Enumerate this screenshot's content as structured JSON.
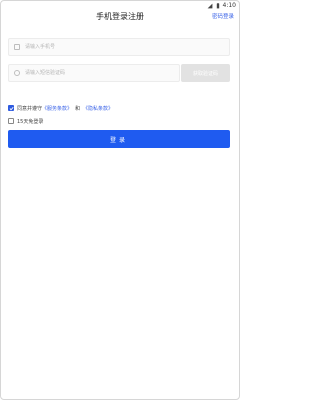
{
  "status": {
    "time": "4:10"
  },
  "header": {
    "title": "手机登录注册",
    "password_login": "密码登录"
  },
  "form": {
    "phone_placeholder": "请输入手机号",
    "code_placeholder": "请输入短信验证码",
    "get_code_label": "获取验证码"
  },
  "agreement": {
    "checked": true,
    "prefix": "同意并遵守",
    "terms_label": "《服务条款》",
    "and": "和",
    "privacy_label": "《隐私条款》"
  },
  "remember": {
    "checked": false,
    "label": "15天免登录"
  },
  "login": {
    "label": "登录"
  },
  "colors": {
    "accent": "#1f5bf0",
    "link": "#3a63e8",
    "disabled": "#e2e2e2"
  }
}
